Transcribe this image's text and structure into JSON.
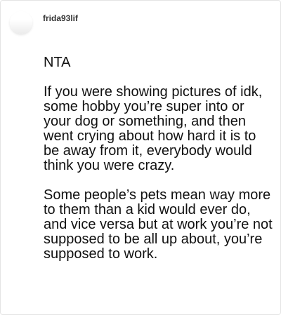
{
  "comment": {
    "username": "frida93lif",
    "paragraphs": [
      "NTA",
      "If you were showing pictures of idk, some hobby you’re super into or your dog or something, and then went crying about how hard it is to be away from it, everybody would think you were crazy.",
      "Some people’s pets mean way more to them than a kid would ever do, and vice versa but at work you’re not supposed to be all up about, you’re supposed to work."
    ]
  }
}
